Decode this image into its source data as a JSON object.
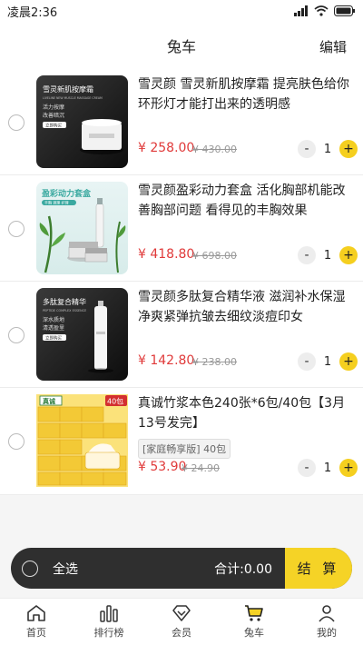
{
  "status": {
    "time": "凌晨2:36"
  },
  "nav": {
    "title": "兔车",
    "edit": "编辑"
  },
  "items": [
    {
      "name": "雪灵颜 雪灵新肌按摩霜 提亮肤色给你环形灯才能打出来的透明感",
      "price": "¥ 258.00",
      "original_price": "¥ 430.00",
      "quantity": "1",
      "thumb": {
        "line1": "雪灵新肌按摩霜",
        "line2": "LIVELINE NEW MUSCLE MASSAGE CREAM",
        "line3": "活力按摩",
        "line4": "改善暗沉",
        "badge": "立即购买"
      }
    },
    {
      "name": "雪灵颜盈彩动力套盒 活化胸部机能改善胸部问题 看得见的丰胸效果",
      "price": "¥ 418.80",
      "original_price": "¥ 698.00",
      "quantity": "1",
      "thumb": {
        "line1": "盈彩动力套盒",
        "line2": "丰胸 调理 护理"
      }
    },
    {
      "name": "雪灵颜多肽复合精华液 滋润补水保湿净爽紧弹抗皱去细纹淡痘印女",
      "price": "¥ 142.80",
      "original_price": "¥ 238.00",
      "quantity": "1",
      "thumb": {
        "line1": "多肽复合精华",
        "line2": "PEPTIDE COMPLEX ESSENCE",
        "line3": "深水质地",
        "line4": "清透盈里",
        "badge": "立即购买"
      }
    },
    {
      "name": "真诚竹浆本色240张*6包/40包【3月13号发完】",
      "tag": "[家庭畅享版] 40包",
      "price": "¥ 53.90",
      "original_price": "¥ 24.90",
      "quantity": "1",
      "thumb": {
        "brand": "真诚",
        "count": "40包"
      }
    }
  ],
  "checkout": {
    "select_all": "全选",
    "total": "合计:0.00",
    "pay": "结 算"
  },
  "tabs": [
    {
      "label": "首页",
      "icon": "home-icon"
    },
    {
      "label": "排行榜",
      "icon": "ranking-icon"
    },
    {
      "label": "会员",
      "icon": "member-diamond-icon"
    },
    {
      "label": "兔车",
      "icon": "cart-icon"
    },
    {
      "label": "我的",
      "icon": "profile-icon"
    }
  ],
  "colors": {
    "accent": "#f5d326",
    "price": "#e03a3a",
    "bar_dark": "#2f2f2f"
  }
}
